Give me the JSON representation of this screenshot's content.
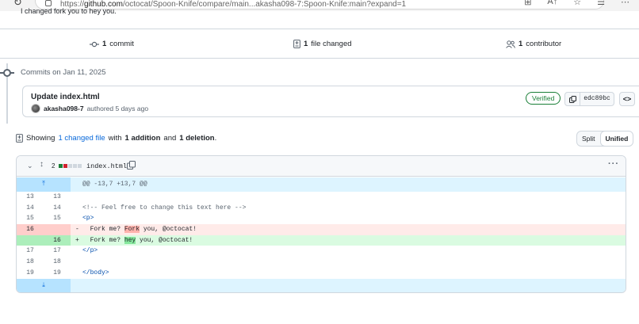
{
  "browser": {
    "url_prefix": "https://",
    "url_host": "github.com",
    "url_path": "/octocat/Spoon-Knife/compare/main...akasha098-7:Spoon-Knife:main?expand=1"
  },
  "previous_text": "I changed fork you to hey you.",
  "summary": {
    "commits_count": "1",
    "commits_label": "commit",
    "files_count": "1",
    "files_label": "file changed",
    "contributors_count": "1",
    "contributors_label": "contributor"
  },
  "timeline": {
    "commits_on": "Commits on Jan 11, 2025"
  },
  "commit": {
    "title": "Update index.html",
    "author": "akasha098-7",
    "authored": "authored 5 days ago",
    "verified": "Verified",
    "sha": "edc89bc",
    "browse": "<>"
  },
  "showing": {
    "prefix": "Showing",
    "changed_files": "1 changed file",
    "with": "with",
    "additions": "1 addition",
    "and": "and",
    "deletions": "1 deletion",
    "period": "."
  },
  "view_toggle": {
    "split": "Split",
    "unified": "Unified"
  },
  "file": {
    "changes": "2",
    "name": "index.html",
    "more": "···"
  },
  "diff": {
    "hunk_header": "@@ -13,7 +13,7 @@",
    "rows": [
      {
        "old": "13",
        "new": "13",
        "text": ""
      },
      {
        "old": "14",
        "new": "14",
        "text": "<!-- Feel free to change this text here -->"
      },
      {
        "old": "15",
        "new": "15",
        "text": "<p>"
      },
      {
        "old": "16",
        "new": "",
        "sign": "-",
        "before": "  Fork me? ",
        "hl": "Fork",
        "after": " you, @octocat!"
      },
      {
        "old": "",
        "new": "16",
        "sign": "+",
        "before": "  Fork me? ",
        "hl": "hey",
        "after": " you, @octocat!"
      },
      {
        "old": "17",
        "new": "17",
        "text": "</p>"
      },
      {
        "old": "18",
        "new": "18",
        "text": ""
      },
      {
        "old": "19",
        "new": "19",
        "text": "</body>"
      }
    ]
  },
  "colors": {
    "link": "#0969da",
    "verified": "#1a7f37",
    "add_bg": "#dafbe1",
    "del_bg": "#ffebe9",
    "hunk_bg": "#ddf4ff"
  }
}
